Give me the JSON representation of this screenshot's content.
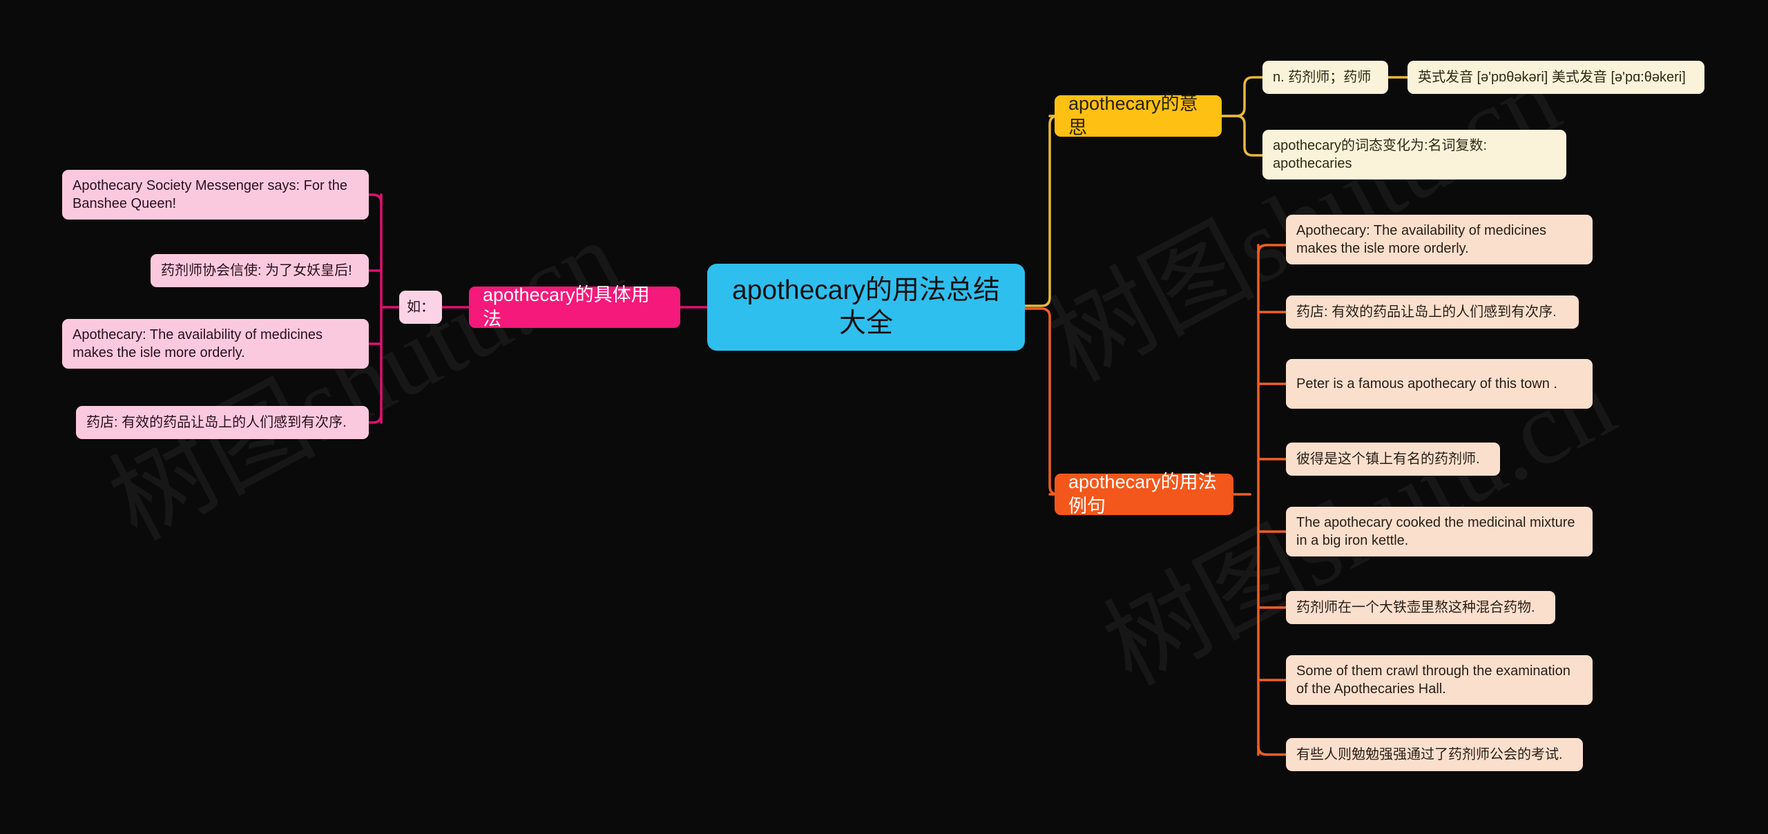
{
  "canvas": {
    "background": "#0a0a0a",
    "watermark_text": "树图shutu.cn"
  },
  "root": {
    "label": "apothecary的用法总结大全",
    "color": "#2ebfee"
  },
  "branches": [
    {
      "id": "meaning",
      "label": "apothecary的意思",
      "color": "#ffc014",
      "leaf_color": "#fbf3d9",
      "children": [
        {
          "label": "n. 药剂师；药师",
          "children": [
            {
              "label": "英式发音 [ə'pɒθəkəri] 美式发音 [ə'pɑ:θəkeri]"
            }
          ]
        },
        {
          "label": "apothecary的词态变化为:名词复数: apothecaries"
        }
      ]
    },
    {
      "id": "examples",
      "label": "apothecary的用法例句",
      "color": "#f4571b",
      "leaf_color": "#fbdfcd",
      "children": [
        {
          "label": "Apothecary: The availability of medicines makes the isle more orderly."
        },
        {
          "label": "药店: 有效的药品让岛上的人们感到有次序."
        },
        {
          "label": "Peter is a famous apothecary of this town ."
        },
        {
          "label": "彼得是这个镇上有名的药剂师."
        },
        {
          "label": "The apothecary cooked the medicinal mixture in a big iron kettle."
        },
        {
          "label": "药剂师在一个大铁壶里熬这种混合药物."
        },
        {
          "label": "Some of them crawl through the examination of the Apothecaries Hall."
        },
        {
          "label": "有些人则勉勉强强通过了药剂师公会的考试."
        }
      ]
    },
    {
      "id": "usage",
      "label": "apothecary的具体用法",
      "color": "#f4197a",
      "leaf_color": "#fbc9de",
      "group_label": "如：",
      "children": [
        {
          "label": "Apothecary Society Messenger says: For the Banshee Queen!"
        },
        {
          "label": "药剂师协会信使: 为了女妖皇后!"
        },
        {
          "label": "Apothecary: The availability of medicines makes the isle more orderly."
        },
        {
          "label": "药店: 有效的药品让岛上的人们感到有次序."
        }
      ]
    }
  ]
}
